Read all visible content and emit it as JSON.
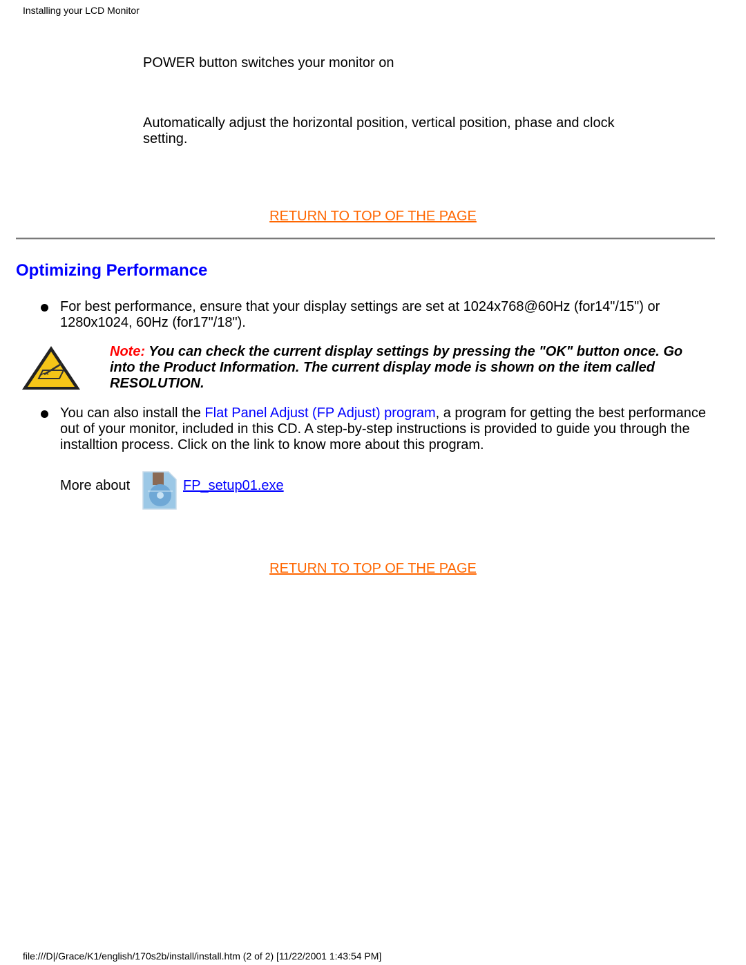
{
  "header": {
    "title": "Installing your LCD Monitor"
  },
  "controls": {
    "power_text": "POWER button switches your monitor on",
    "auto_text": "Automatically adjust the horizontal position, vertical position, phase and clock setting."
  },
  "return_link_1": "RETURN TO TOP OF THE PAGE",
  "section": {
    "title": "Optimizing Performance",
    "bullet_1": "For best performance, ensure that your display settings are set at 1024x768@60Hz (for14\"/15\") or 1280x1024, 60Hz (for17\"/18\").",
    "note_label": "Note:",
    "note_text": " You can check the current display settings by pressing the \"OK\" button once. Go into the Product Information. The current display mode is shown on the item called RESOLUTION.",
    "bullet_2_prefix": "You can also install the ",
    "bullet_2_link": "Flat Panel Adjust (FP Adjust) program",
    "bullet_2_suffix": ", a program for getting the best performance out of your monitor, included in this CD. A step-by-step instructions is provided to guide you through the installtion process. Click on the link to know more about this program.",
    "more_about_label": "More about",
    "file_link": "FP_setup01.exe",
    "icons": {
      "warning": "warning-triangle-icon",
      "file": "cd-setup-file-icon"
    }
  },
  "return_link_2": "RETURN TO TOP OF THE PAGE",
  "footer": {
    "path": "file:///D|/Grace/K1/english/170s2b/install/install.htm (2 of 2) [11/22/2001 1:43:54 PM]"
  },
  "colors": {
    "return_link": "#ff6600",
    "heading": "#0000ff",
    "link": "#0000ff",
    "note_label": "#ff0000"
  }
}
